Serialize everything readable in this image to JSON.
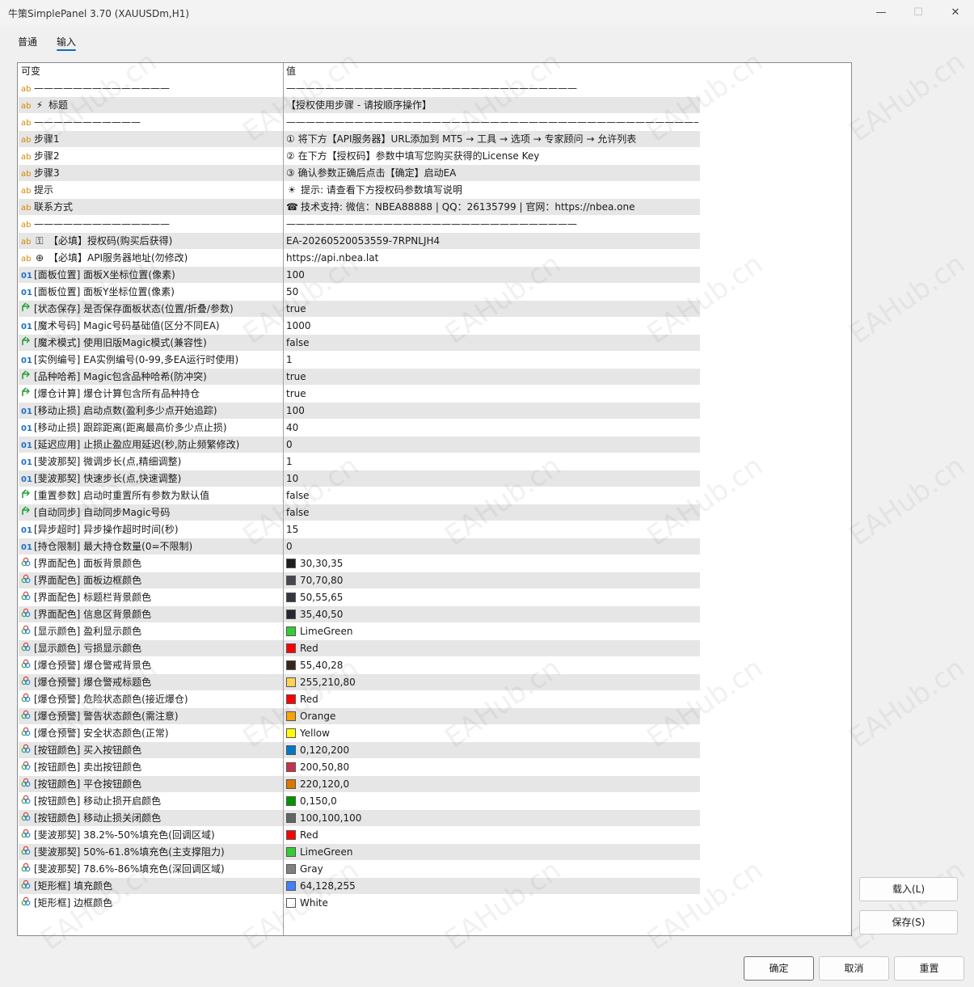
{
  "window": {
    "title": "牛策SimplePanel 3.70 (XAUUSDm,H1)",
    "minimize": "—",
    "maximize": "☐",
    "close": "✕"
  },
  "tabs": [
    {
      "label": "普通"
    },
    {
      "label": "输入"
    }
  ],
  "table": {
    "headers": {
      "variable": "可变",
      "value": "值"
    },
    "rows": [
      {
        "type": "ab",
        "name": "——————————————",
        "value": "——————————————————————————————",
        "icon": ""
      },
      {
        "type": "ab",
        "name": "标题",
        "value": "【授权使用步骤 - 请按顺序操作】",
        "icon": "lightning-icon"
      },
      {
        "type": "ab",
        "name": "———————————",
        "value": "———————————————————————————————————————————",
        "icon": ""
      },
      {
        "type": "ab",
        "name": "步骤1",
        "value": "① 将下方【API服务器】URL添加到 MT5 → 工具 → 选项 → 专家顾问 → 允许列表",
        "icon": ""
      },
      {
        "type": "ab",
        "name": "步骤2",
        "value": "② 在下方【授权码】参数中填写您购买获得的License Key",
        "icon": ""
      },
      {
        "type": "ab",
        "name": "步骤3",
        "value": "③ 确认参数正确后点击【确定】启动EA",
        "icon": ""
      },
      {
        "type": "ab",
        "name": "提示",
        "value": "提示: 请查看下方授权码参数填写说明",
        "icon": "",
        "value_icon": "bulb-icon"
      },
      {
        "type": "ab",
        "name": "联系方式",
        "value": "技术支持: 微信：NBEA88888 | QQ：26135799 | 官网：https://nbea.one",
        "icon": "",
        "value_icon": "phone-icon"
      },
      {
        "type": "ab",
        "name": "——————————————",
        "value": "——————————————————————————————",
        "icon": ""
      },
      {
        "type": "ab",
        "name": "【必填】授权码(购买后获得)",
        "value": "EA-20260520053559-7RPNLJH4",
        "icon": "key-icon"
      },
      {
        "type": "ab",
        "name": "【必填】API服务器地址(勿修改)",
        "value": "https://api.nbea.lat",
        "icon": "globe-icon"
      },
      {
        "type": "01",
        "name": "[面板位置] 面板X坐标位置(像素)",
        "value": "100"
      },
      {
        "type": "01",
        "name": "[面板位置] 面板Y坐标位置(像素)",
        "value": "50"
      },
      {
        "type": "bool",
        "name": "[状态保存] 是否保存面板状态(位置/折叠/参数)",
        "value": "true"
      },
      {
        "type": "01",
        "name": "[魔术号码] Magic号码基础值(区分不同EA)",
        "value": "1000"
      },
      {
        "type": "bool",
        "name": "[魔术模式] 使用旧版Magic模式(兼容性)",
        "value": "false"
      },
      {
        "type": "01",
        "name": "[实例编号] EA实例编号(0-99,多EA运行时使用)",
        "value": "1"
      },
      {
        "type": "bool",
        "name": "[品种哈希] Magic包含品种哈希(防冲突)",
        "value": "true"
      },
      {
        "type": "bool",
        "name": "[爆仓计算] 爆仓计算包含所有品种持仓",
        "value": "true"
      },
      {
        "type": "01",
        "name": "[移动止损] 启动点数(盈利多少点开始追踪)",
        "value": "100"
      },
      {
        "type": "01",
        "name": "[移动止损] 跟踪距离(距离最高价多少点止损)",
        "value": "40"
      },
      {
        "type": "01",
        "name": "[延迟应用] 止损止盈应用延迟(秒,防止频繁修改)",
        "value": "0"
      },
      {
        "type": "01",
        "name": "[斐波那契] 微调步长(点,精细调整)",
        "value": "1"
      },
      {
        "type": "01",
        "name": "[斐波那契] 快速步长(点,快速调整)",
        "value": "10"
      },
      {
        "type": "bool",
        "name": "[重置参数] 启动时重置所有参数为默认值",
        "value": "false"
      },
      {
        "type": "bool",
        "name": "[自动同步] 自动同步Magic号码",
        "value": "false"
      },
      {
        "type": "01",
        "name": "[异步超时] 异步操作超时时间(秒)",
        "value": "15"
      },
      {
        "type": "01",
        "name": "[持仓限制] 最大持仓数量(0=不限制)",
        "value": "0"
      },
      {
        "type": "color",
        "name": "[界面配色] 面板背景颜色",
        "value": "30,30,35",
        "swatch": "#1e1e23"
      },
      {
        "type": "color",
        "name": "[界面配色] 面板边框颜色",
        "value": "70,70,80",
        "swatch": "#464650"
      },
      {
        "type": "color",
        "name": "[界面配色] 标题栏背景颜色",
        "value": "50,55,65",
        "swatch": "#323741"
      },
      {
        "type": "color",
        "name": "[界面配色] 信息区背景颜色",
        "value": "35,40,50",
        "swatch": "#232832"
      },
      {
        "type": "color",
        "name": "[显示颜色] 盈利显示颜色",
        "value": "LimeGreen",
        "swatch": "#32cd32"
      },
      {
        "type": "color",
        "name": "[显示颜色] 亏损显示颜色",
        "value": "Red",
        "swatch": "#ff0000"
      },
      {
        "type": "color",
        "name": "[爆仓预警] 爆仓警戒背景色",
        "value": "55,40,28",
        "swatch": "#37281c"
      },
      {
        "type": "color",
        "name": "[爆仓预警] 爆仓警戒标题色",
        "value": "255,210,80",
        "swatch": "#ffd250"
      },
      {
        "type": "color",
        "name": "[爆仓预警] 危险状态颜色(接近爆仓)",
        "value": "Red",
        "swatch": "#ff0000"
      },
      {
        "type": "color",
        "name": "[爆仓预警] 警告状态颜色(需注意)",
        "value": "Orange",
        "swatch": "#ffa500"
      },
      {
        "type": "color",
        "name": "[爆仓预警] 安全状态颜色(正常)",
        "value": "Yellow",
        "swatch": "#ffff00"
      },
      {
        "type": "color",
        "name": "[按钮颜色] 买入按钮颜色",
        "value": "0,120,200",
        "swatch": "#0078c8"
      },
      {
        "type": "color",
        "name": "[按钮颜色] 卖出按钮颜色",
        "value": "200,50,80",
        "swatch": "#c83250"
      },
      {
        "type": "color",
        "name": "[按钮颜色] 平仓按钮颜色",
        "value": "220,120,0",
        "swatch": "#dc7800"
      },
      {
        "type": "color",
        "name": "[按钮颜色] 移动止损开启颜色",
        "value": "0,150,0",
        "swatch": "#009600"
      },
      {
        "type": "color",
        "name": "[按钮颜色] 移动止损关闭颜色",
        "value": "100,100,100",
        "swatch": "#646464"
      },
      {
        "type": "color",
        "name": "[斐波那契] 38.2%-50%填充色(回调区域)",
        "value": "Red",
        "swatch": "#ff0000"
      },
      {
        "type": "color",
        "name": "[斐波那契] 50%-61.8%填充色(主支撑阻力)",
        "value": "LimeGreen",
        "swatch": "#32cd32"
      },
      {
        "type": "color",
        "name": "[斐波那契] 78.6%-86%填充色(深回调区域)",
        "value": "Gray",
        "swatch": "#808080"
      },
      {
        "type": "color",
        "name": "[矩形框] 填充颜色",
        "value": "64,128,255",
        "swatch": "#4080ff"
      },
      {
        "type": "color",
        "name": "[矩形框] 边框颜色",
        "value": "White",
        "swatch": "#ffffff"
      }
    ]
  },
  "side_buttons": {
    "load": "载入(L)",
    "save": "保存(S)"
  },
  "footer_buttons": {
    "ok": "确定",
    "cancel": "取消",
    "reset": "重置"
  },
  "watermark": "EAHub.cn",
  "type_labels": {
    "ab": "ab",
    "01": "01"
  }
}
